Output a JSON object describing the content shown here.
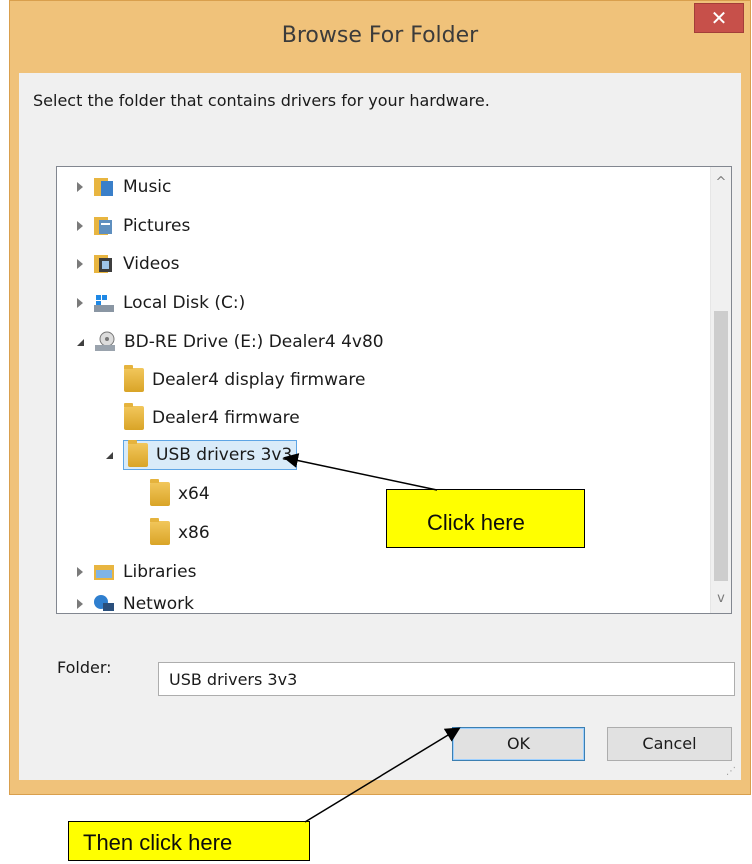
{
  "dialog": {
    "title": "Browse For Folder",
    "close_glyph": "✕",
    "instruction": "Select the folder that contains drivers for your hardware.",
    "tree": [
      {
        "label": "Music",
        "icon": "music-folder-icon",
        "expander": "collapsed"
      },
      {
        "label": "Pictures",
        "icon": "pictures-folder-icon",
        "expander": "collapsed"
      },
      {
        "label": "Videos",
        "icon": "videos-folder-icon",
        "expander": "collapsed"
      },
      {
        "label": "Local Disk (C:)",
        "icon": "local-disk-icon",
        "expander": "collapsed"
      },
      {
        "label": "BD-RE Drive (E:) Dealer4 4v80",
        "icon": "optical-drive-icon",
        "expander": "expanded"
      },
      {
        "label": "Dealer4 display firmware",
        "icon": "folder-icon",
        "expander": "none"
      },
      {
        "label": "Dealer4 firmware",
        "icon": "folder-icon",
        "expander": "none"
      },
      {
        "label": "USB drivers 3v3",
        "icon": "folder-icon",
        "expander": "expanded",
        "selected": true
      },
      {
        "label": "x64",
        "icon": "folder-icon",
        "expander": "none"
      },
      {
        "label": "x86",
        "icon": "folder-icon",
        "expander": "none"
      },
      {
        "label": "Libraries",
        "icon": "libraries-icon",
        "expander": "collapsed"
      },
      {
        "label": "Network",
        "icon": "network-icon",
        "expander": "collapsed"
      }
    ],
    "folder_label": "Folder:",
    "folder_value": "USB drivers 3v3",
    "ok_label": "OK",
    "cancel_label": "Cancel"
  },
  "annotations": {
    "callout_1": "Click here",
    "callout_2": "Then click here"
  },
  "colors": {
    "frame": "#f0c27a",
    "close": "#c7504a",
    "selection": "#d9ebf9",
    "callout": "#ffff00"
  }
}
